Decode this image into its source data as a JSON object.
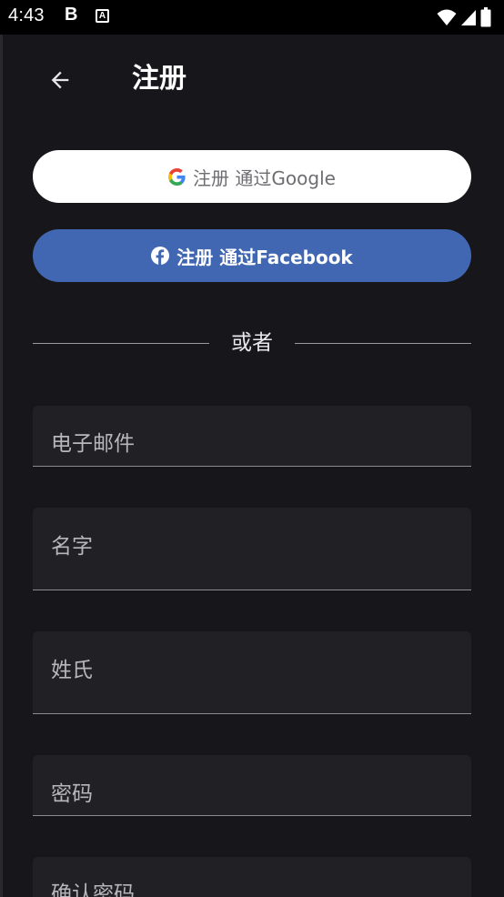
{
  "status_bar": {
    "time": "4:43",
    "notif_b": "B",
    "notif_a": "A"
  },
  "header": {
    "title": "注册"
  },
  "social": {
    "google_label": "注册 通过Google",
    "facebook_label": "注册 通过Facebook"
  },
  "divider": {
    "text": "或者"
  },
  "form": {
    "email_label": "电子邮件",
    "first_name_label": "名字",
    "last_name_label": "姓氏",
    "password_label": "密码",
    "confirm_password_label": "确认密码"
  },
  "colors": {
    "background": "#17171b",
    "field_background": "#202025",
    "facebook_blue": "#4267b2",
    "google_button": "#ffffff"
  },
  "icons": {
    "back": "arrow-left-icon",
    "google": "google-g-icon",
    "facebook": "facebook-f-icon",
    "wifi": "wifi-icon",
    "signal": "signal-icon",
    "battery": "battery-icon"
  }
}
